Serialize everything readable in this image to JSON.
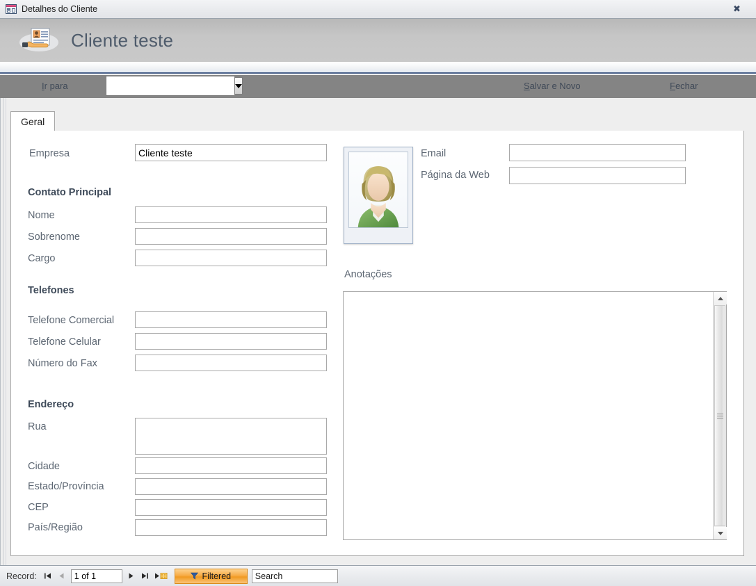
{
  "window": {
    "title": "Detalhes do Cliente",
    "icon": "access-form-icon",
    "close_label": "✖"
  },
  "banner": {
    "title": "Cliente teste",
    "icon": "contact-card-hand-icon"
  },
  "command_bar": {
    "goto_label": "Ir para",
    "goto_accel": "I",
    "goto_value": "",
    "goto_placeholder": "",
    "save_and_new_label": "Salvar e Novo",
    "save_and_new_accel": "S",
    "close_label": "Fechar",
    "close_accel": "F",
    "dropdown_icon": "chevron-down-icon"
  },
  "tabs": [
    {
      "label": "Geral",
      "active": true
    }
  ],
  "form": {
    "company": {
      "label": "Empresa",
      "value": "Cliente teste"
    },
    "sections": [
      {
        "heading": "Contato Principal",
        "fields": [
          {
            "label": "Nome",
            "value": ""
          },
          {
            "label": "Sobrenome",
            "value": ""
          },
          {
            "label": "Cargo",
            "value": ""
          }
        ]
      },
      {
        "heading": "Telefones",
        "fields": [
          {
            "label": "Telefone Comercial",
            "value": ""
          },
          {
            "label": "Telefone Celular",
            "value": ""
          },
          {
            "label": "Número do Fax",
            "value": ""
          }
        ]
      },
      {
        "heading": "Endereço",
        "fields": [
          {
            "label": "Rua",
            "value": ""
          },
          {
            "label": "Cidade",
            "value": ""
          },
          {
            "label": "Estado/Província",
            "value": ""
          },
          {
            "label": "CEP",
            "value": ""
          },
          {
            "label": "País/Região",
            "value": ""
          }
        ]
      }
    ],
    "right": {
      "photo_alt": "person-placeholder-photo",
      "email": {
        "label": "Email",
        "value": ""
      },
      "website": {
        "label": "Página da Web",
        "value": ""
      },
      "notes": {
        "label": "Anotações",
        "value": ""
      }
    }
  },
  "record_nav": {
    "label": "Record:",
    "first_icon": "first-record-icon",
    "prev_icon": "previous-record-icon",
    "position": "1 of 1",
    "next_icon": "next-record-icon",
    "last_icon": "last-record-icon",
    "new_icon": "new-record-icon",
    "filter_label": "Filtered",
    "filter_icon": "funnel-icon",
    "search_value": "Search"
  },
  "colors": {
    "banner_gray": "#c3c3c3",
    "command_bar_gray": "#848484",
    "accent_blue": "#49618a",
    "filter_orange": "#f09a22",
    "label_gray": "#5d6773",
    "heading_gray": "#3e4a59"
  }
}
